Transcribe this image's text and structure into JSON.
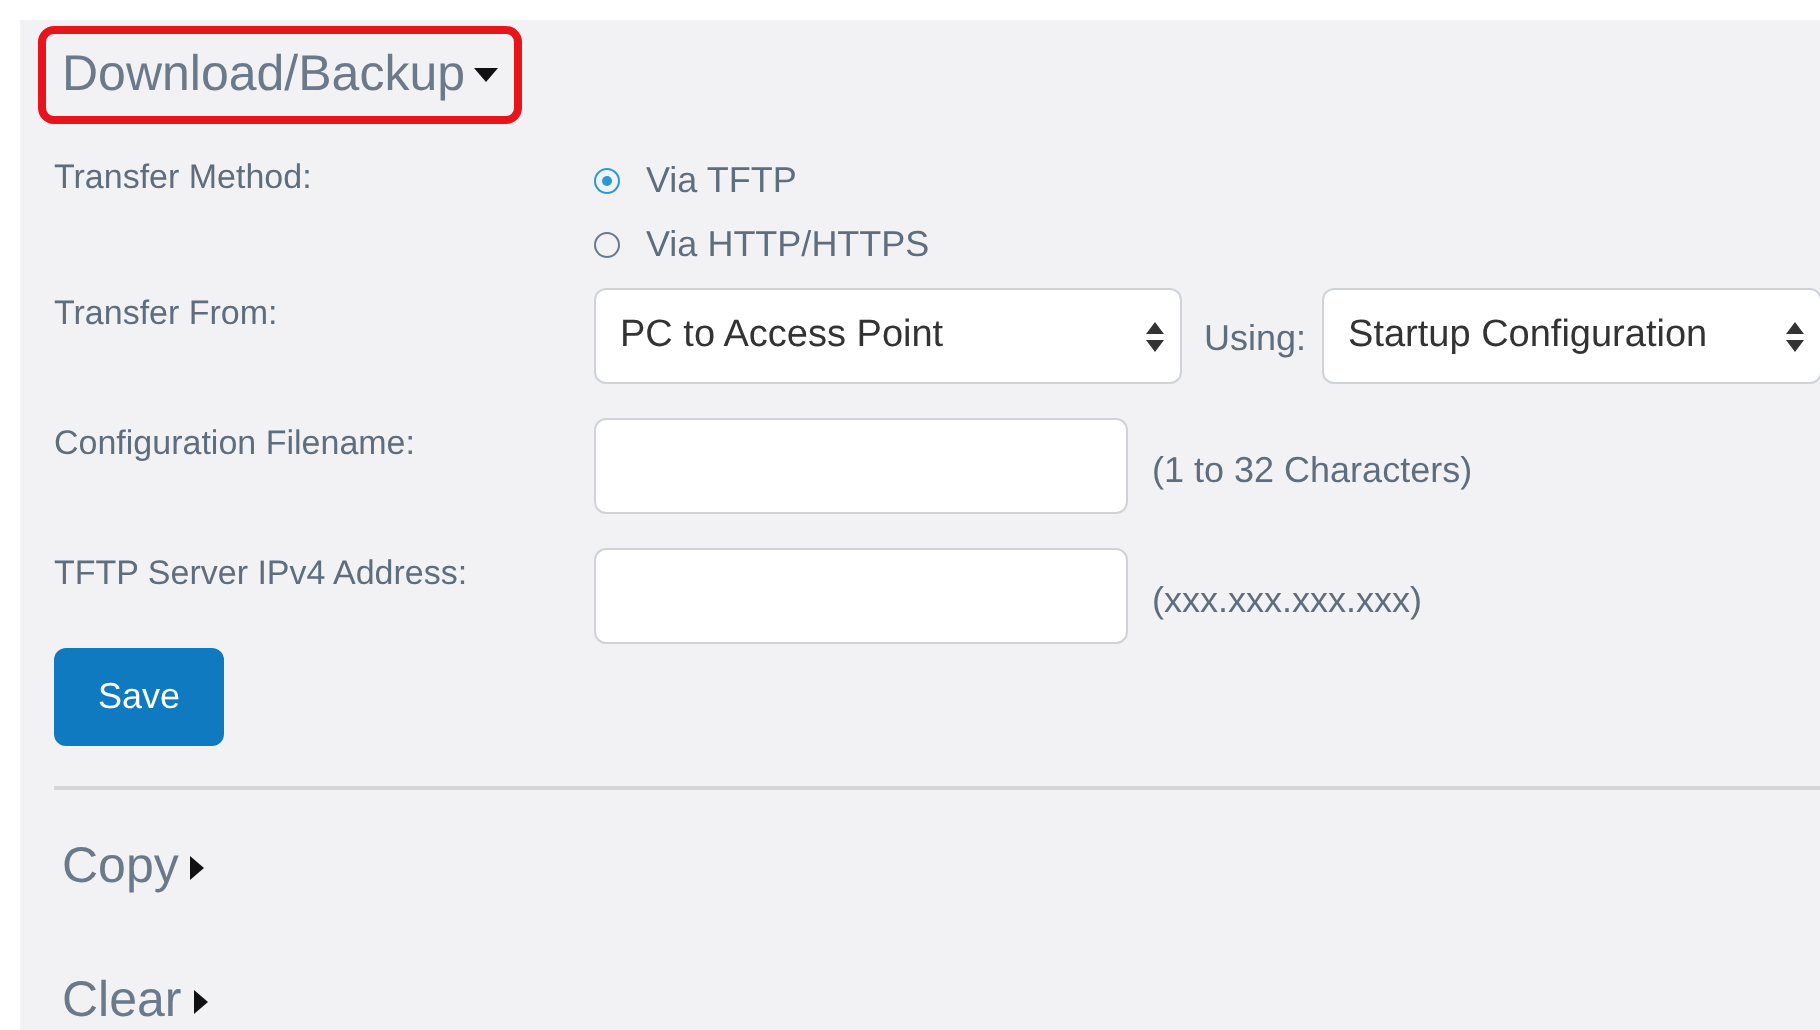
{
  "download_backup": {
    "title": "Download/Backup",
    "expanded": true,
    "highlighted": true
  },
  "transfer_method": {
    "label": "Transfer Method:",
    "options": [
      {
        "label": "Via TFTP",
        "selected": true
      },
      {
        "label": "Via HTTP/HTTPS",
        "selected": false
      }
    ]
  },
  "transfer_from": {
    "label": "Transfer From:",
    "value": "PC to Access Point",
    "using_label": "Using:",
    "using_value": "Startup Configuration"
  },
  "filename": {
    "label": "Configuration Filename:",
    "hint": "(1 to 32 Characters)"
  },
  "server": {
    "label": "TFTP Server IPv4 Address:",
    "hint": "(xxx.xxx.xxx.xxx)"
  },
  "save_button": "Save",
  "collapsed_sections": [
    {
      "title": "Copy",
      "expanded": false
    },
    {
      "title": "Clear",
      "expanded": false
    }
  ]
}
